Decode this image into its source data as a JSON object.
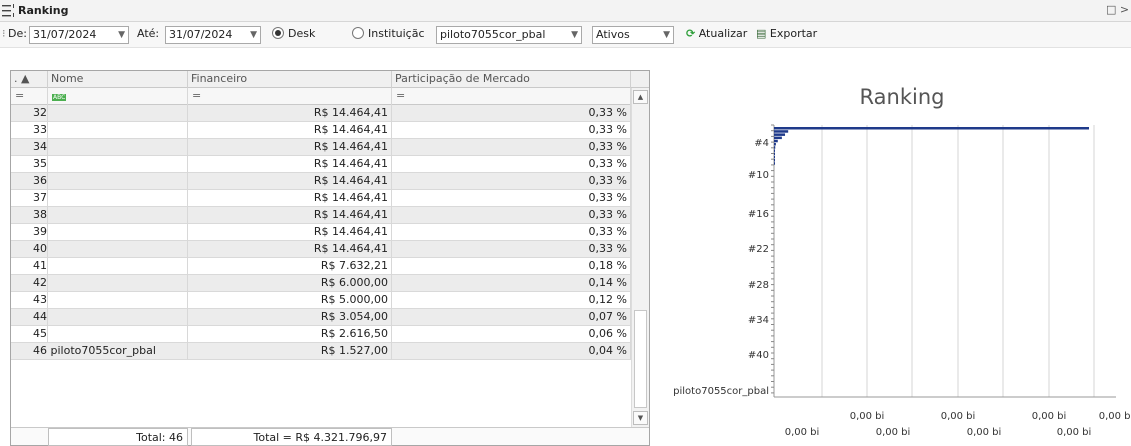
{
  "window": {
    "title": "Ranking",
    "close": "□ >"
  },
  "toolbar": {
    "de_label": "De:",
    "de_value": "31/07/2024",
    "ate_label": "Até:",
    "ate_value": "31/07/2024",
    "radio_desk": "Desk",
    "radio_instituicao": "Instituiçãc",
    "user_combo": "piloto7055cor_pbal",
    "status_combo": "Ativos",
    "refresh_label": "Atualizar",
    "export_label": "Exportar"
  },
  "grid": {
    "headers": [
      ". ▲",
      "Nome",
      "Financeiro",
      "Participação de Mercado"
    ],
    "filter": [
      "=",
      "ABC",
      "=",
      "="
    ],
    "rows": [
      {
        "rank": "32",
        "nome": "",
        "financeiro": "R$ 14.464,41",
        "participacao": "0,33 %"
      },
      {
        "rank": "33",
        "nome": "",
        "financeiro": "R$ 14.464,41",
        "participacao": "0,33 %"
      },
      {
        "rank": "34",
        "nome": "",
        "financeiro": "R$ 14.464,41",
        "participacao": "0,33 %"
      },
      {
        "rank": "35",
        "nome": "",
        "financeiro": "R$ 14.464,41",
        "participacao": "0,33 %"
      },
      {
        "rank": "36",
        "nome": "",
        "financeiro": "R$ 14.464,41",
        "participacao": "0,33 %"
      },
      {
        "rank": "37",
        "nome": "",
        "financeiro": "R$ 14.464,41",
        "participacao": "0,33 %"
      },
      {
        "rank": "38",
        "nome": "",
        "financeiro": "R$ 14.464,41",
        "participacao": "0,33 %"
      },
      {
        "rank": "39",
        "nome": "",
        "financeiro": "R$ 14.464,41",
        "participacao": "0,33 %"
      },
      {
        "rank": "40",
        "nome": "",
        "financeiro": "R$ 14.464,41",
        "participacao": "0,33 %"
      },
      {
        "rank": "41",
        "nome": "",
        "financeiro": "R$ 7.632,21",
        "participacao": "0,18 %"
      },
      {
        "rank": "42",
        "nome": "",
        "financeiro": "R$ 6.000,00",
        "participacao": "0,14 %"
      },
      {
        "rank": "43",
        "nome": "",
        "financeiro": "R$ 5.000,00",
        "participacao": "0,12 %"
      },
      {
        "rank": "44",
        "nome": "",
        "financeiro": "R$ 3.054,00",
        "participacao": "0,07 %"
      },
      {
        "rank": "45",
        "nome": "",
        "financeiro": "R$ 2.616,50",
        "participacao": "0,06 %"
      },
      {
        "rank": "46",
        "nome": "46 piloto7055cor_pbal",
        "financeiro": "R$ 1.527,00",
        "participacao": "0,04 %"
      }
    ],
    "total_count": "Total: 46",
    "total_value": "Total = R$ 4.321.796,97"
  },
  "chart_data": {
    "type": "bar",
    "title": "Ranking",
    "orientation": "horizontal",
    "y_tick_labels": [
      "#4",
      "#10",
      "#16",
      "#22",
      "#28",
      "#34",
      "#40",
      "piloto7055cor_pbal"
    ],
    "x_tick_labels_row1": [
      "0,00 bi",
      "0,00 bi",
      "0,00 bi",
      "0,00 bi"
    ],
    "x_tick_labels_row2": [
      "0,00 bi",
      "0,00 bi",
      "0,00 bi",
      "0,00 bi"
    ],
    "bar_color": "#1f3a8a",
    "bars_relative": [
      1.0,
      0.045,
      0.035,
      0.025,
      0.012,
      0.006,
      0.004,
      0.003,
      0.003,
      0.003,
      0.003,
      0.003
    ]
  }
}
